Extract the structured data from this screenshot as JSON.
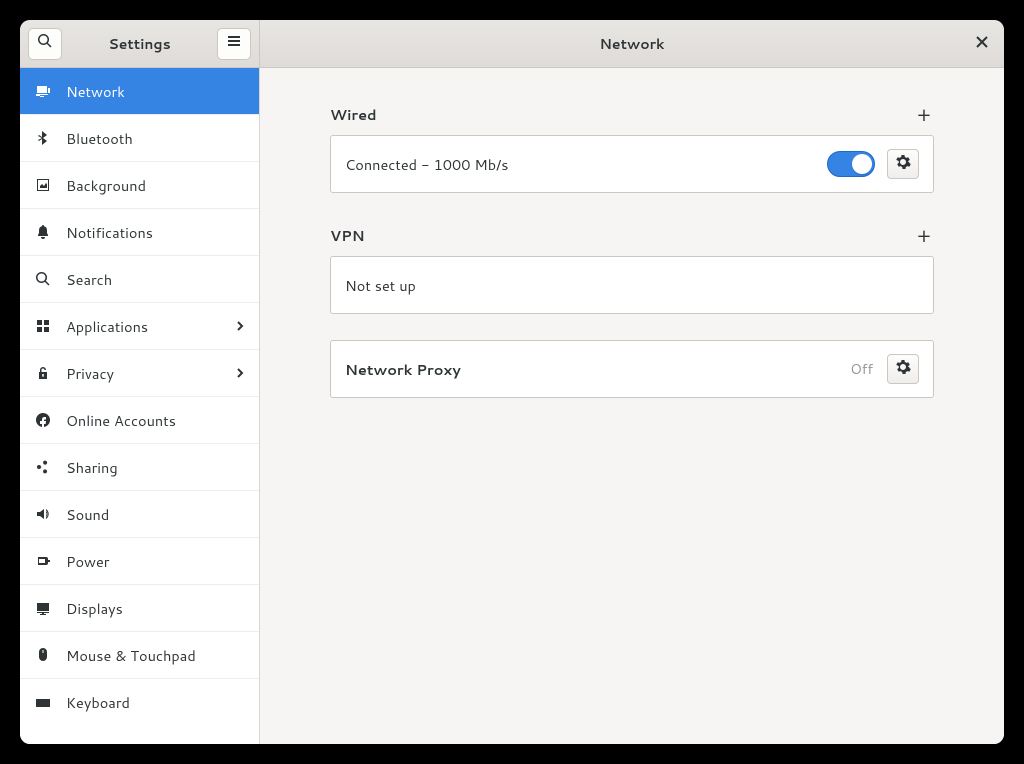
{
  "header": {
    "sidebar_title": "Settings",
    "main_title": "Network"
  },
  "sidebar": {
    "items": [
      {
        "icon": "network",
        "label": "Network",
        "active": true
      },
      {
        "icon": "bluetooth",
        "label": "Bluetooth"
      },
      {
        "icon": "background",
        "label": "Background"
      },
      {
        "icon": "bell",
        "label": "Notifications"
      },
      {
        "icon": "search",
        "label": "Search"
      },
      {
        "icon": "applications",
        "label": "Applications",
        "chevron": true
      },
      {
        "icon": "privacy",
        "label": "Privacy",
        "chevron": true
      },
      {
        "icon": "online-accounts",
        "label": "Online Accounts"
      },
      {
        "icon": "sharing",
        "label": "Sharing"
      },
      {
        "icon": "sound",
        "label": "Sound"
      },
      {
        "icon": "power",
        "label": "Power"
      },
      {
        "icon": "displays",
        "label": "Displays"
      },
      {
        "icon": "mouse",
        "label": "Mouse & Touchpad"
      },
      {
        "icon": "keyboard",
        "label": "Keyboard"
      }
    ]
  },
  "content": {
    "wired": {
      "title": "Wired",
      "status": "Connected - 1000 Mb/s",
      "switch_on": true
    },
    "vpn": {
      "title": "VPN",
      "status": "Not set up"
    },
    "proxy": {
      "title": "Network Proxy",
      "status": "Off"
    }
  }
}
